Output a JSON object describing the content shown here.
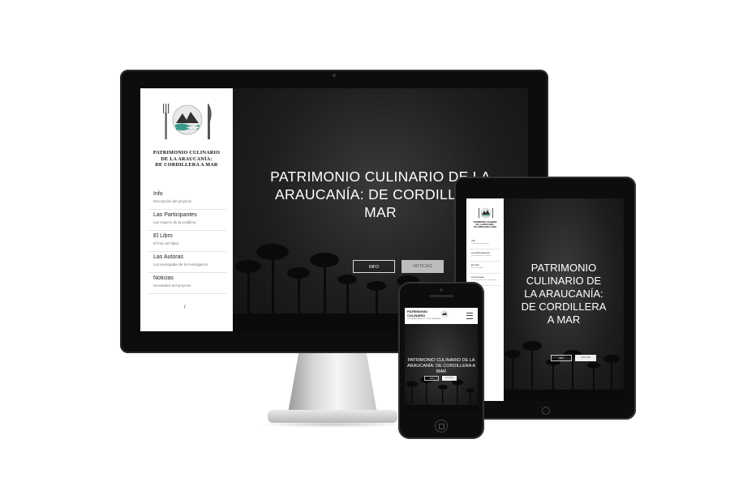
{
  "site": {
    "brand_lines": [
      "PATRIMONIO CULINARIO",
      "DE LA ARAUCANÍA:",
      "DE CORDILLERA A MAR"
    ],
    "hero_title_desktop": [
      "PATRIMONIO CULINARIO DE LA",
      "ARAUCANÍA: DE CORDILLERA",
      "MAR"
    ],
    "hero_title_tablet": [
      "PATRIMONIO",
      "CULINARIO DE",
      "LA ARAUCANÍA:",
      "DE CORDILLERA",
      "A MAR"
    ],
    "hero_title_phone": [
      "PATRIMONIO CULINARIO DE LA",
      "ARAUCANÍA: DE CORDILLERA A",
      "MAR"
    ],
    "buttons": {
      "info": "INFO",
      "news": "NOTICIAS"
    },
    "nav": [
      {
        "title": "Info",
        "subtitle": "Descripción del proyecto"
      },
      {
        "title": "Las Participantes",
        "subtitle": "Las mujeres de la cordillera"
      },
      {
        "title": "El Libro",
        "subtitle": "El fruto del labor"
      },
      {
        "title": "Las Autoras",
        "subtitle": "Las encargadas de la investigación"
      },
      {
        "title": "Noticias",
        "subtitle": "Novedades del proyecto"
      }
    ],
    "social": "f",
    "phone_header": {
      "brand_lines": [
        "PATRIMONIO",
        "CULINARIO"
      ],
      "subtitle": "DE LA ARAUCANÍA: DE CORDILLERA A MAR"
    }
  },
  "colors": {
    "screen_dark": "#1a1a1a",
    "sidebar": "#ffffff",
    "button_news": "#bdbdbd",
    "device_frame": "#0c0c0c"
  },
  "icons": [
    "fork-icon",
    "knife-icon",
    "mountain-logo-icon",
    "facebook-icon",
    "hamburger-menu-icon",
    "home-button-icon"
  ]
}
